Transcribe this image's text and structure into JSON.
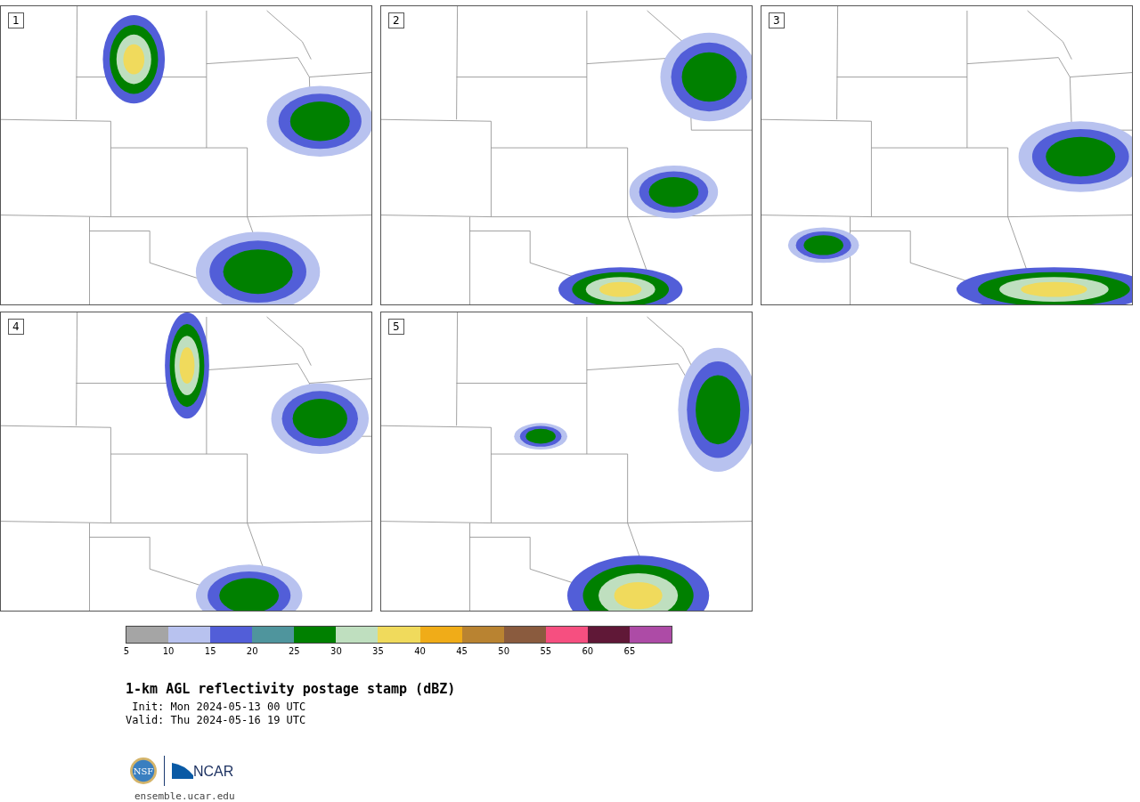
{
  "panels": [
    {
      "label": "1"
    },
    {
      "label": "2"
    },
    {
      "label": "3"
    },
    {
      "label": "4"
    },
    {
      "label": "5"
    }
  ],
  "colorbar": [
    {
      "color": "#a5a5a5",
      "tick": "5"
    },
    {
      "color": "#b8c2ef",
      "tick": "10"
    },
    {
      "color": "#525ed8",
      "tick": "15"
    },
    {
      "color": "#4f959d",
      "tick": "20"
    },
    {
      "color": "#008000",
      "tick": "25"
    },
    {
      "color": "#bfdfbf",
      "tick": "30"
    },
    {
      "color": "#f0da5c",
      "tick": "35"
    },
    {
      "color": "#f0ac18",
      "tick": "40"
    },
    {
      "color": "#b98331",
      "tick": "45"
    },
    {
      "color": "#8a5b3e",
      "tick": "50"
    },
    {
      "color": "#f64f80",
      "tick": "55"
    },
    {
      "color": "#601837",
      "tick": "60"
    },
    {
      "color": "#ad4ba6",
      "tick": "65"
    }
  ],
  "title": "1-km AGL reflectivity postage stamp (dBZ)",
  "times": [
    "Init: Mon 2024-05-13 00 UTC",
    "Valid: Thu 2024-05-16 19 UTC"
  ],
  "logos": {
    "seal": "NSF",
    "wordmark": "NCAR"
  },
  "footer": "ensemble.ucar.edu"
}
